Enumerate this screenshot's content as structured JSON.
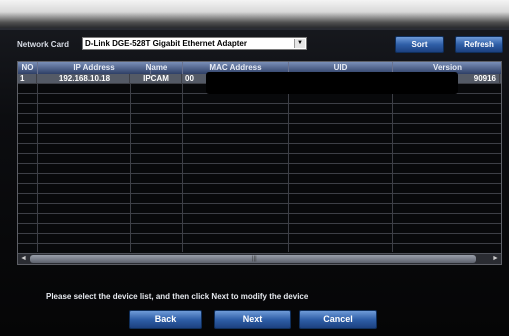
{
  "network_card": {
    "label": "Network Card",
    "selected_value": "D-Link DGE-528T Gigabit Ethernet Adapter"
  },
  "toolbar": {
    "sort_label": "Sort",
    "refresh_label": "Refresh"
  },
  "table": {
    "columns": [
      "NO",
      "IP Address",
      "Name",
      "MAC Address",
      "UID",
      "Version"
    ],
    "rows": [
      {
        "no": "1",
        "ip": "192.168.10.18",
        "name": "IPCAM",
        "mac": "00",
        "uid": "",
        "version": "90916"
      }
    ]
  },
  "instruction": "Please select the device list, and then click Next to modify the device",
  "footer": {
    "back_label": "Back",
    "next_label": "Next",
    "cancel_label": "Cancel"
  },
  "colors": {
    "button_blue": "#2f5fa8",
    "window_bg": "#0c0d10",
    "selected_row": "#545a66"
  }
}
